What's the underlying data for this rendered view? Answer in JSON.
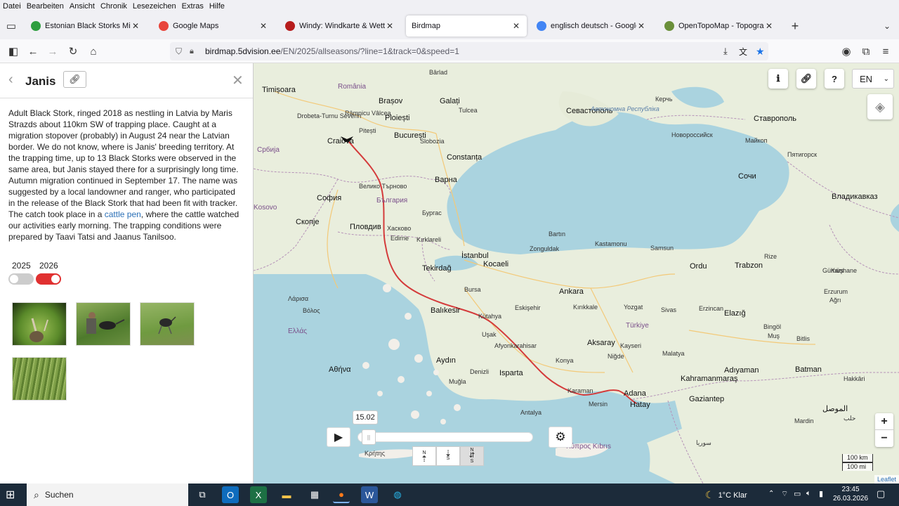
{
  "menu": [
    "Datei",
    "Bearbeiten",
    "Ansicht",
    "Chronik",
    "Lesezeichen",
    "Extras",
    "Hilfe"
  ],
  "tabs": [
    {
      "title": "Estonian Black Storks Migration",
      "color": "#2e9e3f"
    },
    {
      "title": "Google Maps",
      "color": "#e8453c"
    },
    {
      "title": "Windy: Windkarte & Wettervorh",
      "color": "#b71c1c"
    },
    {
      "title": "Birdmap",
      "color": "",
      "active": true
    },
    {
      "title": "englisch deutsch - Google Such",
      "color": "#4285f4"
    },
    {
      "title": "OpenTopoMap - Topographisch",
      "color": "#6a8f3a"
    }
  ],
  "url": {
    "host": "birdmap.5dvision.ee",
    "path": "/EN/2025/allseasons/?line=1&track=0&speed=1"
  },
  "panel": {
    "name": "Janis",
    "description_pre": "Adult Black Stork, ringed 2018 as nestling in Latvia by Maris Strazds about 110km SW of trapping place. Caught at a migration stopover (probably) in August 24 near the Latvian border. We do not know, where is Janis' breeding territory. At the trapping time, up to 13 Black Storks were observed in the same area, but Janis stayed there for a surprisingly long time. Autumn migration continued in September 17. The name was suggested by a local landowner and ranger, who participated in the release of the Black Stork that had been fit with tracker. The catch took place in a ",
    "description_link": "cattle pen",
    "description_post": ", where the cattle watched our activities early morning. The trapping conditions were prepared by Taavi Tatsi and Jaanus Tanilsoo.",
    "years": [
      {
        "label": "2025",
        "on": false
      },
      {
        "label": "2026",
        "on": true
      }
    ]
  },
  "map": {
    "lang": "EN",
    "date": "15.02",
    "scale_km": "100 km",
    "scale_mi": "100 mi",
    "attribution": "Leaflet",
    "route_color": "#d43b3b",
    "labels": [
      {
        "t": "Timișoara",
        "c": "cap"
      },
      {
        "t": "România",
        "c": "country"
      },
      {
        "t": "Brașov",
        "c": "cap"
      },
      {
        "t": "Bârlad",
        "c": ""
      },
      {
        "t": "Galați",
        "c": "cap"
      },
      {
        "t": "Tulcea",
        "c": ""
      },
      {
        "t": "Drobeta-Turnu Severin",
        "c": ""
      },
      {
        "t": "Râmnicu Vâlcea",
        "c": ""
      },
      {
        "t": "Ploiești",
        "c": "cap"
      },
      {
        "t": "Pitești",
        "c": ""
      },
      {
        "t": "București",
        "c": "cap"
      },
      {
        "t": "Slobozia",
        "c": ""
      },
      {
        "t": "Craiova",
        "c": "cap"
      },
      {
        "t": "Constanța",
        "c": "cap"
      },
      {
        "t": "Србија",
        "c": "country"
      },
      {
        "t": "Варна",
        "c": "cap"
      },
      {
        "t": "Велико Търново",
        "c": ""
      },
      {
        "t": "България",
        "c": "country"
      },
      {
        "t": "София",
        "c": "cap"
      },
      {
        "t": "Бургас",
        "c": ""
      },
      {
        "t": "Пловдив",
        "c": "cap"
      },
      {
        "t": "Хасково",
        "c": ""
      },
      {
        "t": "Kosovo",
        "c": "country"
      },
      {
        "t": "Скопје",
        "c": "cap"
      },
      {
        "t": "Edirne",
        "c": ""
      },
      {
        "t": "Kırklareli",
        "c": ""
      },
      {
        "t": "İstanbul",
        "c": "cap"
      },
      {
        "t": "Tekirdağ",
        "c": "cap"
      },
      {
        "t": "Kocaeli",
        "c": "cap"
      },
      {
        "t": "Bartın",
        "c": ""
      },
      {
        "t": "Kastamonu",
        "c": ""
      },
      {
        "t": "Zonguldak",
        "c": ""
      },
      {
        "t": "Samsun",
        "c": ""
      },
      {
        "t": "Ordu",
        "c": "cap"
      },
      {
        "t": "Trabzon",
        "c": "cap"
      },
      {
        "t": "Rize",
        "c": ""
      },
      {
        "t": "Bursa",
        "c": ""
      },
      {
        "t": "Balıkesir",
        "c": "cap"
      },
      {
        "t": "Ankara",
        "c": "cap"
      },
      {
        "t": "Eskişehir",
        "c": ""
      },
      {
        "t": "Kırıkkale",
        "c": ""
      },
      {
        "t": "Yozgat",
        "c": ""
      },
      {
        "t": "Türkiye",
        "c": "country"
      },
      {
        "t": "Sivas",
        "c": ""
      },
      {
        "t": "Erzincan",
        "c": ""
      },
      {
        "t": "Elazığ",
        "c": "cap"
      },
      {
        "t": "Kütahya",
        "c": ""
      },
      {
        "t": "Uşak",
        "c": ""
      },
      {
        "t": "Afyonkarahisar",
        "c": ""
      },
      {
        "t": "Aksaray",
        "c": "cap"
      },
      {
        "t": "Kayseri",
        "c": ""
      },
      {
        "t": "Niğde",
        "c": ""
      },
      {
        "t": "Malatya",
        "c": ""
      },
      {
        "t": "Adıyaman",
        "c": "cap"
      },
      {
        "t": "Batman",
        "c": "cap"
      },
      {
        "t": "Aydın",
        "c": "cap"
      },
      {
        "t": "Denizli",
        "c": ""
      },
      {
        "t": "Isparta",
        "c": "cap"
      },
      {
        "t": "Konya",
        "c": ""
      },
      {
        "t": "Karaman",
        "c": ""
      },
      {
        "t": "Adana",
        "c": "cap"
      },
      {
        "t": "Kahramanmaraş",
        "c": "cap"
      },
      {
        "t": "Gaziantep",
        "c": "cap"
      },
      {
        "t": "Hatay",
        "c": "cap"
      },
      {
        "t": "Muğla",
        "c": ""
      },
      {
        "t": "Mersin",
        "c": ""
      },
      {
        "t": "Antalya",
        "c": ""
      },
      {
        "t": "Ελλάς",
        "c": "country"
      },
      {
        "t": "Αθήνα",
        "c": "cap"
      },
      {
        "t": "Βόλος",
        "c": ""
      },
      {
        "t": "Λάρισα",
        "c": ""
      },
      {
        "t": "Κρήτης",
        "c": ""
      },
      {
        "t": "Κύπρος Kıbrıs",
        "c": "country"
      },
      {
        "t": "Севастополь",
        "c": "cap"
      },
      {
        "t": "Керчь",
        "c": ""
      },
      {
        "t": "Новороссийск",
        "c": ""
      },
      {
        "t": "Ставрополь",
        "c": "cap"
      },
      {
        "t": "Майкоп",
        "c": ""
      },
      {
        "t": "Сочи",
        "c": "cap"
      },
      {
        "t": "Пятигорск",
        "c": ""
      },
      {
        "t": "Владикавказ",
        "c": "cap"
      },
      {
        "t": "Автономна Республіка",
        "c": "sea"
      },
      {
        "t": "Mardin",
        "c": ""
      },
      {
        "t": "Bitlis",
        "c": ""
      },
      {
        "t": "Muş",
        "c": ""
      },
      {
        "t": "Bingöl",
        "c": ""
      },
      {
        "t": "Kars",
        "c": ""
      },
      {
        "t": "Ağrı",
        "c": ""
      },
      {
        "t": "Hakkâri",
        "c": ""
      },
      {
        "t": "Gümüşhane",
        "c": ""
      },
      {
        "t": "Erzurum",
        "c": ""
      },
      {
        "t": "الموصل",
        "c": "cap"
      },
      {
        "t": "سوريا",
        "c": ""
      },
      {
        "t": "حلب",
        "c": ""
      }
    ]
  },
  "taskbar": {
    "search": "Suchen",
    "weather": "1°C  Klar",
    "time": "23:45",
    "date": "26.03.2026"
  }
}
